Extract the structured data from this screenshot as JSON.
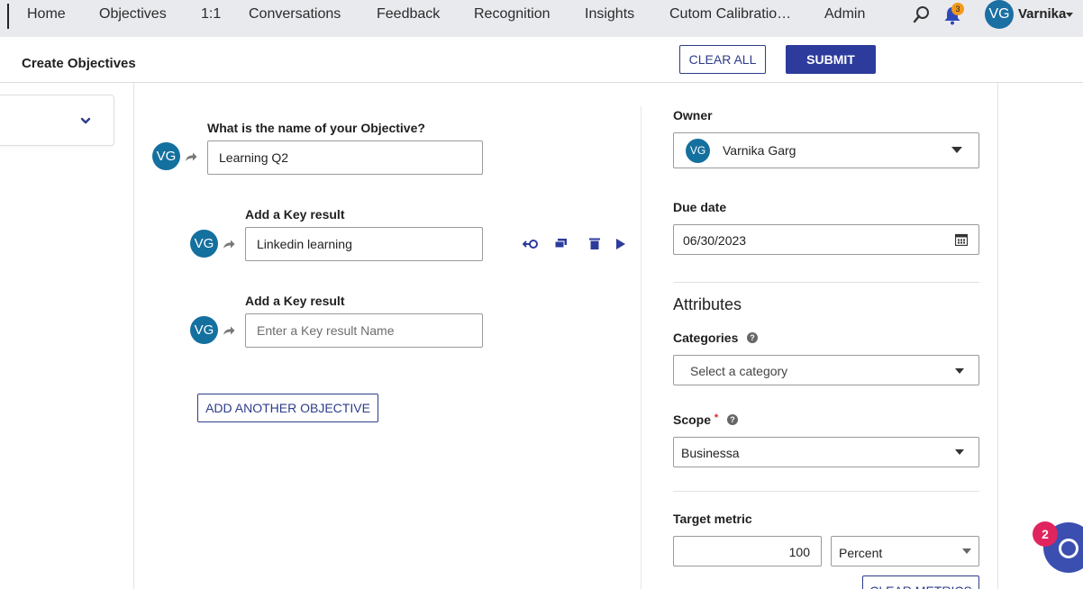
{
  "nav": {
    "items": [
      "Home",
      "Objectives",
      "1:1",
      "Conversations",
      "Feedback",
      "Recognition",
      "Insights",
      "Cutom Calibratio…",
      "Admin"
    ],
    "notification_count": "3",
    "user_initials": "VG",
    "user_name": "Varnika"
  },
  "header": {
    "title": "Create Objectives",
    "clear_all": "CLEAR ALL",
    "submit": "SUBMIT"
  },
  "objective": {
    "question": "What is the name of your Objective?",
    "avatar": "VG",
    "value": "Learning Q2",
    "key_results": [
      {
        "label": "Add a Key result",
        "avatar": "VG",
        "value": "Linkedin learning",
        "placeholder": ""
      },
      {
        "label": "Add a Key result",
        "avatar": "VG",
        "value": "",
        "placeholder": "Enter a Key result Name"
      }
    ],
    "add_another": "ADD ANOTHER OBJECTIVE"
  },
  "right": {
    "owner_label": "Owner",
    "owner_initials": "VG",
    "owner_name": "Varnika Garg",
    "due_label": "Due date",
    "due_value": "06/30/2023",
    "attributes_title": "Attributes",
    "categories_label": "Categories",
    "categories_placeholder": "Select a category",
    "scope_label": "Scope",
    "scope_required": "*",
    "scope_value": "Businessa",
    "target_metric_label": "Target metric",
    "target_value": "100",
    "target_unit": "Percent",
    "clear_metrics": "CLEAR METRICS"
  },
  "help_glyph": "?",
  "widget_badge": "2",
  "colors": {
    "primary": "#2d3c9c",
    "avatar": "#14709e",
    "nav_bg": "#e9eaee",
    "badge": "#e0245e",
    "bell_badge": "#f39a1d"
  }
}
